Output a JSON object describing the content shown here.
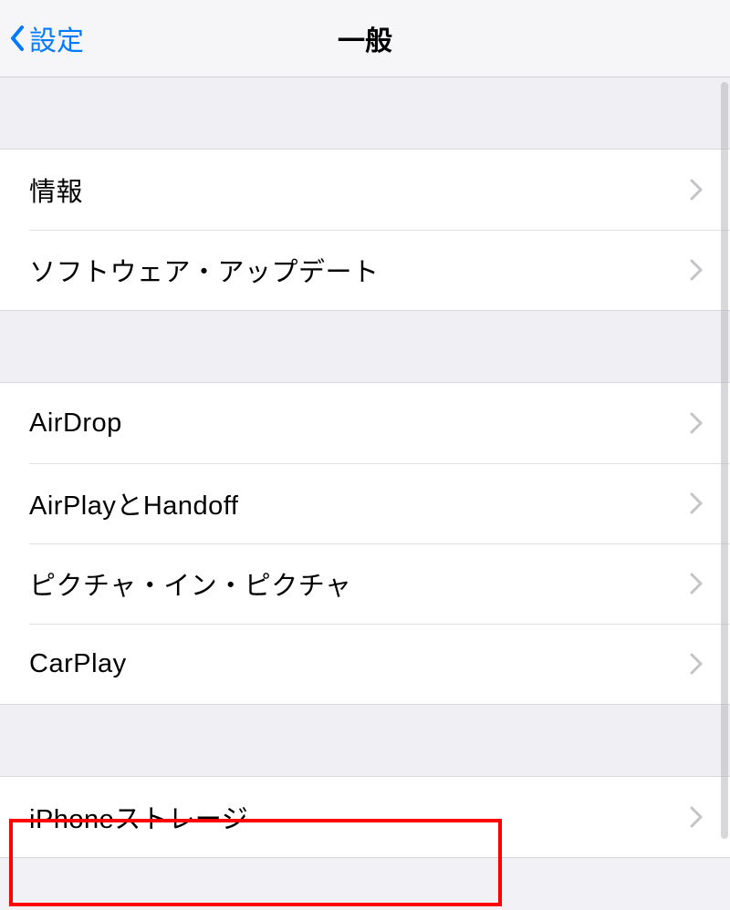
{
  "nav": {
    "back_label": "設定",
    "title": "一般"
  },
  "sections": [
    {
      "rows": [
        {
          "label": "情報"
        },
        {
          "label": "ソフトウェア・アップデート"
        }
      ]
    },
    {
      "rows": [
        {
          "label": "AirDrop"
        },
        {
          "label": "AirPlayとHandoff"
        },
        {
          "label": "ピクチャ・イン・ピクチャ"
        },
        {
          "label": "CarPlay"
        }
      ]
    },
    {
      "rows": [
        {
          "label": "iPhoneストレージ"
        }
      ]
    }
  ]
}
